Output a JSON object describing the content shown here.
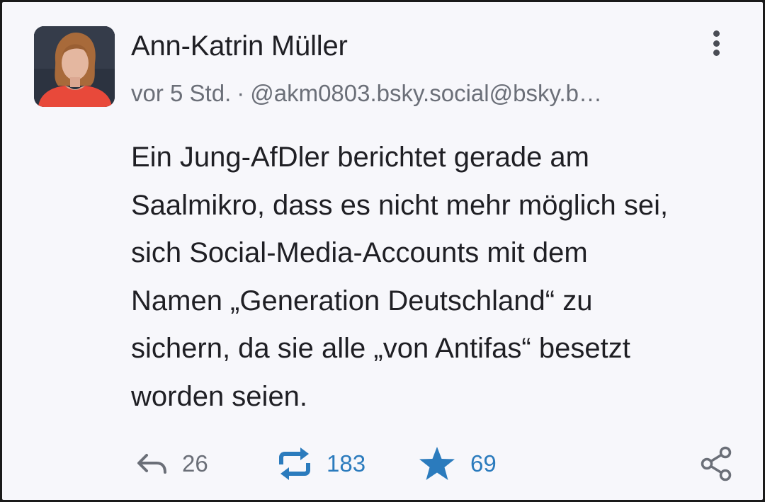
{
  "post": {
    "author_name": "Ann-Katrin Müller",
    "time_ago": "vor 5 Std.",
    "separator": "·",
    "handle": "@akm0803.bsky.social@bsky.b…",
    "body_lines": [
      "Ein Jung-AfDler berichtet gerade am",
      "Saalmikro, dass es nicht mehr möglich sei,",
      "sich Social-Media-Accounts mit dem",
      "Namen „Generation Deutschland“ zu",
      "sichern, da sie alle „von Antifas“ besetzt",
      "worden seien."
    ]
  },
  "actions": {
    "reply": {
      "icon": "reply-icon",
      "count": "26"
    },
    "boost": {
      "icon": "boost-icon",
      "count": "183"
    },
    "favourite": {
      "icon": "star-icon",
      "count": "69"
    },
    "share": {
      "icon": "share-icon"
    }
  },
  "colors": {
    "background": "#f7f7fb",
    "text": "#1f1f24",
    "muted": "#6b6f78",
    "accent": "#2b7bbd"
  }
}
